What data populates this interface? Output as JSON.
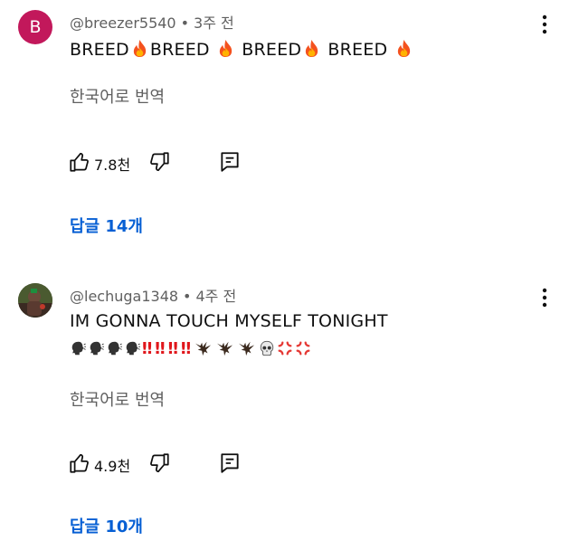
{
  "comments": [
    {
      "avatar_letter": "B",
      "avatar_color": "#c2185b",
      "author": "@breezer5540",
      "separator": "•",
      "time": "3주 전",
      "words": [
        "BREED",
        "BREED",
        "BREED",
        "BREED"
      ],
      "translate": "한국어로 번역",
      "likes": "7.8천",
      "replies": "답글 14개",
      "icons": [
        "fire-icon",
        "thumbs-up-icon",
        "thumbs-down-icon",
        "reply-icon",
        "more-vert-icon"
      ]
    },
    {
      "avatar": "profile-photo",
      "author": "@lechuga1348",
      "separator": "•",
      "time": "4주 전",
      "text": "IM GONNA TOUCH MYSELF TONIGHT",
      "emoji_line": {
        "speaking_heads": 4,
        "double_exclamations": [
          "‼",
          "‼",
          "‼",
          "‼"
        ],
        "eagles": 3,
        "skull": 1,
        "anger": 2
      },
      "translate": "한국어로 번역",
      "likes": "4.9천",
      "replies": "답글 10개",
      "icons": [
        "speaking-head-icon",
        "double-exclamation-icon",
        "eagle-icon",
        "skull-icon",
        "anger-icon",
        "thumbs-up-icon",
        "thumbs-down-icon",
        "reply-icon",
        "more-vert-icon"
      ]
    }
  ],
  "colors": {
    "link": "#065fd4",
    "meta": "#606060",
    "text": "#0f0f0f",
    "exclamation": "#e0161b"
  }
}
